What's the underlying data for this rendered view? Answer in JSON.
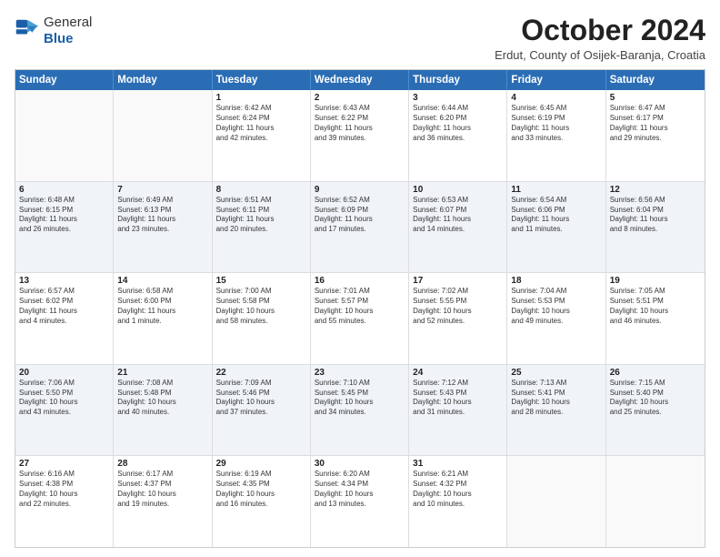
{
  "header": {
    "logo": {
      "general": "General",
      "blue": "Blue"
    },
    "title": "October 2024",
    "location": "Erdut, County of Osijek-Baranja, Croatia"
  },
  "days": [
    "Sunday",
    "Monday",
    "Tuesday",
    "Wednesday",
    "Thursday",
    "Friday",
    "Saturday"
  ],
  "weeks": [
    [
      {
        "day": "",
        "empty": true
      },
      {
        "day": "",
        "empty": true
      },
      {
        "day": "1",
        "line1": "Sunrise: 6:42 AM",
        "line2": "Sunset: 6:24 PM",
        "line3": "Daylight: 11 hours",
        "line4": "and 42 minutes."
      },
      {
        "day": "2",
        "line1": "Sunrise: 6:43 AM",
        "line2": "Sunset: 6:22 PM",
        "line3": "Daylight: 11 hours",
        "line4": "and 39 minutes."
      },
      {
        "day": "3",
        "line1": "Sunrise: 6:44 AM",
        "line2": "Sunset: 6:20 PM",
        "line3": "Daylight: 11 hours",
        "line4": "and 36 minutes."
      },
      {
        "day": "4",
        "line1": "Sunrise: 6:45 AM",
        "line2": "Sunset: 6:19 PM",
        "line3": "Daylight: 11 hours",
        "line4": "and 33 minutes."
      },
      {
        "day": "5",
        "line1": "Sunrise: 6:47 AM",
        "line2": "Sunset: 6:17 PM",
        "line3": "Daylight: 11 hours",
        "line4": "and 29 minutes."
      }
    ],
    [
      {
        "day": "6",
        "line1": "Sunrise: 6:48 AM",
        "line2": "Sunset: 6:15 PM",
        "line3": "Daylight: 11 hours",
        "line4": "and 26 minutes."
      },
      {
        "day": "7",
        "line1": "Sunrise: 6:49 AM",
        "line2": "Sunset: 6:13 PM",
        "line3": "Daylight: 11 hours",
        "line4": "and 23 minutes."
      },
      {
        "day": "8",
        "line1": "Sunrise: 6:51 AM",
        "line2": "Sunset: 6:11 PM",
        "line3": "Daylight: 11 hours",
        "line4": "and 20 minutes."
      },
      {
        "day": "9",
        "line1": "Sunrise: 6:52 AM",
        "line2": "Sunset: 6:09 PM",
        "line3": "Daylight: 11 hours",
        "line4": "and 17 minutes."
      },
      {
        "day": "10",
        "line1": "Sunrise: 6:53 AM",
        "line2": "Sunset: 6:07 PM",
        "line3": "Daylight: 11 hours",
        "line4": "and 14 minutes."
      },
      {
        "day": "11",
        "line1": "Sunrise: 6:54 AM",
        "line2": "Sunset: 6:06 PM",
        "line3": "Daylight: 11 hours",
        "line4": "and 11 minutes."
      },
      {
        "day": "12",
        "line1": "Sunrise: 6:56 AM",
        "line2": "Sunset: 6:04 PM",
        "line3": "Daylight: 11 hours",
        "line4": "and 8 minutes."
      }
    ],
    [
      {
        "day": "13",
        "line1": "Sunrise: 6:57 AM",
        "line2": "Sunset: 6:02 PM",
        "line3": "Daylight: 11 hours",
        "line4": "and 4 minutes."
      },
      {
        "day": "14",
        "line1": "Sunrise: 6:58 AM",
        "line2": "Sunset: 6:00 PM",
        "line3": "Daylight: 11 hours",
        "line4": "and 1 minute."
      },
      {
        "day": "15",
        "line1": "Sunrise: 7:00 AM",
        "line2": "Sunset: 5:58 PM",
        "line3": "Daylight: 10 hours",
        "line4": "and 58 minutes."
      },
      {
        "day": "16",
        "line1": "Sunrise: 7:01 AM",
        "line2": "Sunset: 5:57 PM",
        "line3": "Daylight: 10 hours",
        "line4": "and 55 minutes."
      },
      {
        "day": "17",
        "line1": "Sunrise: 7:02 AM",
        "line2": "Sunset: 5:55 PM",
        "line3": "Daylight: 10 hours",
        "line4": "and 52 minutes."
      },
      {
        "day": "18",
        "line1": "Sunrise: 7:04 AM",
        "line2": "Sunset: 5:53 PM",
        "line3": "Daylight: 10 hours",
        "line4": "and 49 minutes."
      },
      {
        "day": "19",
        "line1": "Sunrise: 7:05 AM",
        "line2": "Sunset: 5:51 PM",
        "line3": "Daylight: 10 hours",
        "line4": "and 46 minutes."
      }
    ],
    [
      {
        "day": "20",
        "line1": "Sunrise: 7:06 AM",
        "line2": "Sunset: 5:50 PM",
        "line3": "Daylight: 10 hours",
        "line4": "and 43 minutes."
      },
      {
        "day": "21",
        "line1": "Sunrise: 7:08 AM",
        "line2": "Sunset: 5:48 PM",
        "line3": "Daylight: 10 hours",
        "line4": "and 40 minutes."
      },
      {
        "day": "22",
        "line1": "Sunrise: 7:09 AM",
        "line2": "Sunset: 5:46 PM",
        "line3": "Daylight: 10 hours",
        "line4": "and 37 minutes."
      },
      {
        "day": "23",
        "line1": "Sunrise: 7:10 AM",
        "line2": "Sunset: 5:45 PM",
        "line3": "Daylight: 10 hours",
        "line4": "and 34 minutes."
      },
      {
        "day": "24",
        "line1": "Sunrise: 7:12 AM",
        "line2": "Sunset: 5:43 PM",
        "line3": "Daylight: 10 hours",
        "line4": "and 31 minutes."
      },
      {
        "day": "25",
        "line1": "Sunrise: 7:13 AM",
        "line2": "Sunset: 5:41 PM",
        "line3": "Daylight: 10 hours",
        "line4": "and 28 minutes."
      },
      {
        "day": "26",
        "line1": "Sunrise: 7:15 AM",
        "line2": "Sunset: 5:40 PM",
        "line3": "Daylight: 10 hours",
        "line4": "and 25 minutes."
      }
    ],
    [
      {
        "day": "27",
        "line1": "Sunrise: 6:16 AM",
        "line2": "Sunset: 4:38 PM",
        "line3": "Daylight: 10 hours",
        "line4": "and 22 minutes."
      },
      {
        "day": "28",
        "line1": "Sunrise: 6:17 AM",
        "line2": "Sunset: 4:37 PM",
        "line3": "Daylight: 10 hours",
        "line4": "and 19 minutes."
      },
      {
        "day": "29",
        "line1": "Sunrise: 6:19 AM",
        "line2": "Sunset: 4:35 PM",
        "line3": "Daylight: 10 hours",
        "line4": "and 16 minutes."
      },
      {
        "day": "30",
        "line1": "Sunrise: 6:20 AM",
        "line2": "Sunset: 4:34 PM",
        "line3": "Daylight: 10 hours",
        "line4": "and 13 minutes."
      },
      {
        "day": "31",
        "line1": "Sunrise: 6:21 AM",
        "line2": "Sunset: 4:32 PM",
        "line3": "Daylight: 10 hours",
        "line4": "and 10 minutes."
      },
      {
        "day": "",
        "empty": true
      },
      {
        "day": "",
        "empty": true
      }
    ]
  ]
}
